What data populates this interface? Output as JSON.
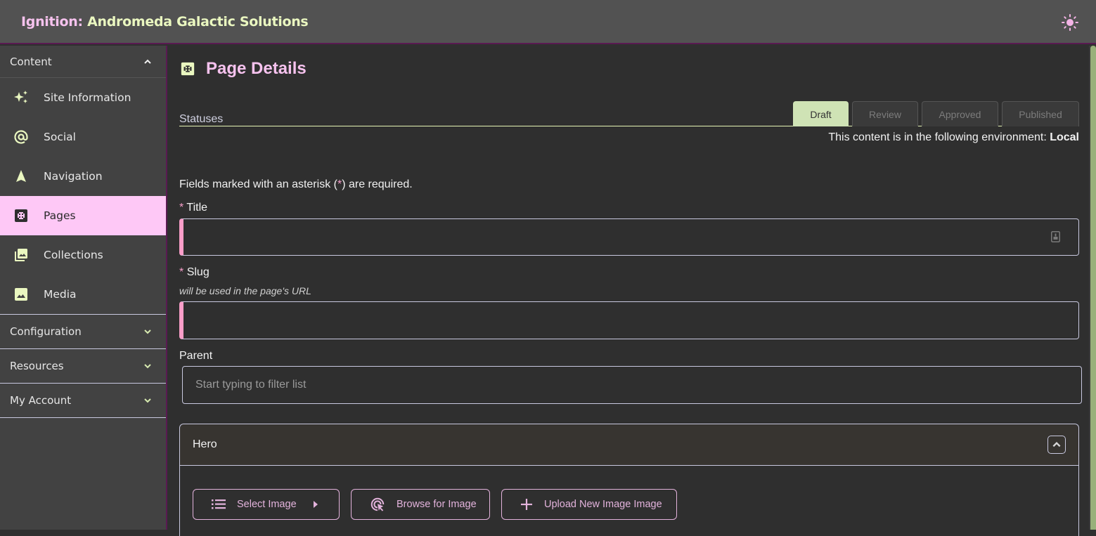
{
  "header": {
    "title_prefix": "Ignition:",
    "title_main": " Andromeda Galactic Solutions",
    "theme_toggle_icon": "sun-icon"
  },
  "sidebar": {
    "content_section": {
      "label": "Content",
      "expanded": true
    },
    "items": [
      {
        "label": "Site Information",
        "icon": "sparkles-icon",
        "active": false
      },
      {
        "label": "Social",
        "icon": "at-sign-icon",
        "active": false
      },
      {
        "label": "Navigation",
        "icon": "navigation-arrow-icon",
        "active": false
      },
      {
        "label": "Pages",
        "icon": "page-frame-icon",
        "active": true
      },
      {
        "label": "Collections",
        "icon": "image-collection-icon",
        "active": false
      },
      {
        "label": "Media",
        "icon": "image-icon",
        "active": false
      }
    ],
    "collapsed_sections": [
      {
        "label": "Configuration"
      },
      {
        "label": "Resources"
      },
      {
        "label": "My Account"
      }
    ]
  },
  "main": {
    "page_title": "Page Details",
    "statuses_label": "Statuses",
    "status_tabs": [
      {
        "label": "Draft",
        "active": true
      },
      {
        "label": "Review",
        "active": false
      },
      {
        "label": "Approved",
        "active": false
      },
      {
        "label": "Published",
        "active": false
      }
    ],
    "environment_text": "This content is in the following environment: ",
    "environment_value": "Local",
    "required_note_pre": "Fields marked with an asterisk (",
    "required_note_ast": "*",
    "required_note_post": ") are required.",
    "fields": {
      "title": {
        "asterisk": "*",
        "label": "Title",
        "value": ""
      },
      "slug": {
        "asterisk": "*",
        "label": "Slug",
        "help": "will be used in the page's URL",
        "value": ""
      },
      "parent": {
        "label": "Parent",
        "placeholder": "Start typing to filter list",
        "value": ""
      }
    },
    "hero": {
      "title": "Hero",
      "buttons": {
        "select": "Select Image",
        "browse": "Browse for Image",
        "upload": "Upload New Image Image"
      }
    }
  },
  "colors": {
    "accent_pink": "#f6c2ee",
    "accent_green": "#eaf7c0",
    "active_nav_bg": "#fec8f6",
    "active_tab_bg": "#cfe3b5",
    "required_marker": "#fb9ec9"
  }
}
